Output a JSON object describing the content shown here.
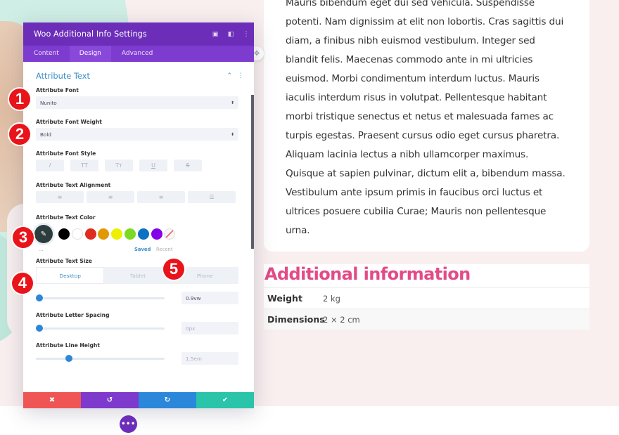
{
  "article": {
    "lines": [
      "Mauris bibendum eget dui sed vehicula. Suspendisse",
      "potenti. Nam dignissim at elit non lobortis. Cras sagittis dui",
      "diam, a finibus nibh euismod vestibulum. Integer sed",
      "blandit felis. Maecenas commodo ante in mi ultricies",
      "euismod. Morbi condimentum interdum luctus. Mauris",
      "iaculis interdum risus in volutpat. Pellentesque habitant",
      "morbi tristique senectus et netus et malesuada fames ac",
      "turpis egestas. Praesent cursus odio eget cursus pharetra.",
      "Aliquam lacinia lectus a nibh ullamcorper maximus.",
      "Quisque at sapien pulvinar, dictum elit a, bibendum massa.",
      "Vestibulum ante ipsum primis in faucibus orci luctus et",
      "ultrices posuere cubilia Curae; Mauris non pellentesque",
      "urna."
    ]
  },
  "additional_info": {
    "title": "Additional information",
    "title_color": "#e24b86",
    "rows": [
      {
        "label": "Weight",
        "value": "2 kg"
      },
      {
        "label": "Dimensions",
        "value": "2 × 2 cm"
      }
    ]
  },
  "panel": {
    "title": "Woo Additional Info Settings",
    "header_icons": [
      "focus-icon",
      "split-view-icon",
      "more-icon"
    ],
    "tabs": [
      {
        "label": "Content",
        "active": false
      },
      {
        "label": "Design",
        "active": true
      },
      {
        "label": "Advanced",
        "active": false
      }
    ],
    "section_title": "Attribute Text",
    "fields": {
      "font": {
        "label": "Attribute Font",
        "value": "Nunito"
      },
      "font_weight": {
        "label": "Attribute Font Weight",
        "value": "Bold"
      },
      "font_style": {
        "label": "Attribute Font Style",
        "buttons": [
          "I",
          "TT",
          "Tт",
          "U",
          "S"
        ]
      },
      "text_alignment": {
        "label": "Attribute Text Alignment",
        "buttons": [
          "align-left",
          "align-center",
          "align-right",
          "align-justify"
        ]
      },
      "text_color": {
        "label": "Attribute Text Color",
        "swatches": [
          "#000000",
          "#ffffff",
          "#e02b20",
          "#e09900",
          "#edf000",
          "#7cda24",
          "#0c71c3",
          "#8300e9"
        ],
        "more": "...",
        "saved_label": "Saved",
        "recent_label": "Recent"
      },
      "text_size": {
        "label": "Attribute Text Size",
        "devices": [
          {
            "label": "Desktop",
            "active": true
          },
          {
            "label": "Tablet",
            "active": false
          },
          {
            "label": "Phone",
            "active": false
          }
        ],
        "value": "0.9vw",
        "slider_fraction": 0.0
      },
      "letter_spacing": {
        "label": "Attribute Letter Spacing",
        "value": "0px",
        "slider_fraction": 0.0
      },
      "line_height": {
        "label": "Attribute Line Height",
        "value": "1.5em",
        "slider_fraction": 0.24
      }
    },
    "footer": {
      "cancel": "✖",
      "undo": "↺",
      "redo": "↻",
      "save": "✔"
    }
  },
  "fab": {
    "label": "•••"
  },
  "badges": [
    "1",
    "2",
    "3",
    "4",
    "5"
  ]
}
